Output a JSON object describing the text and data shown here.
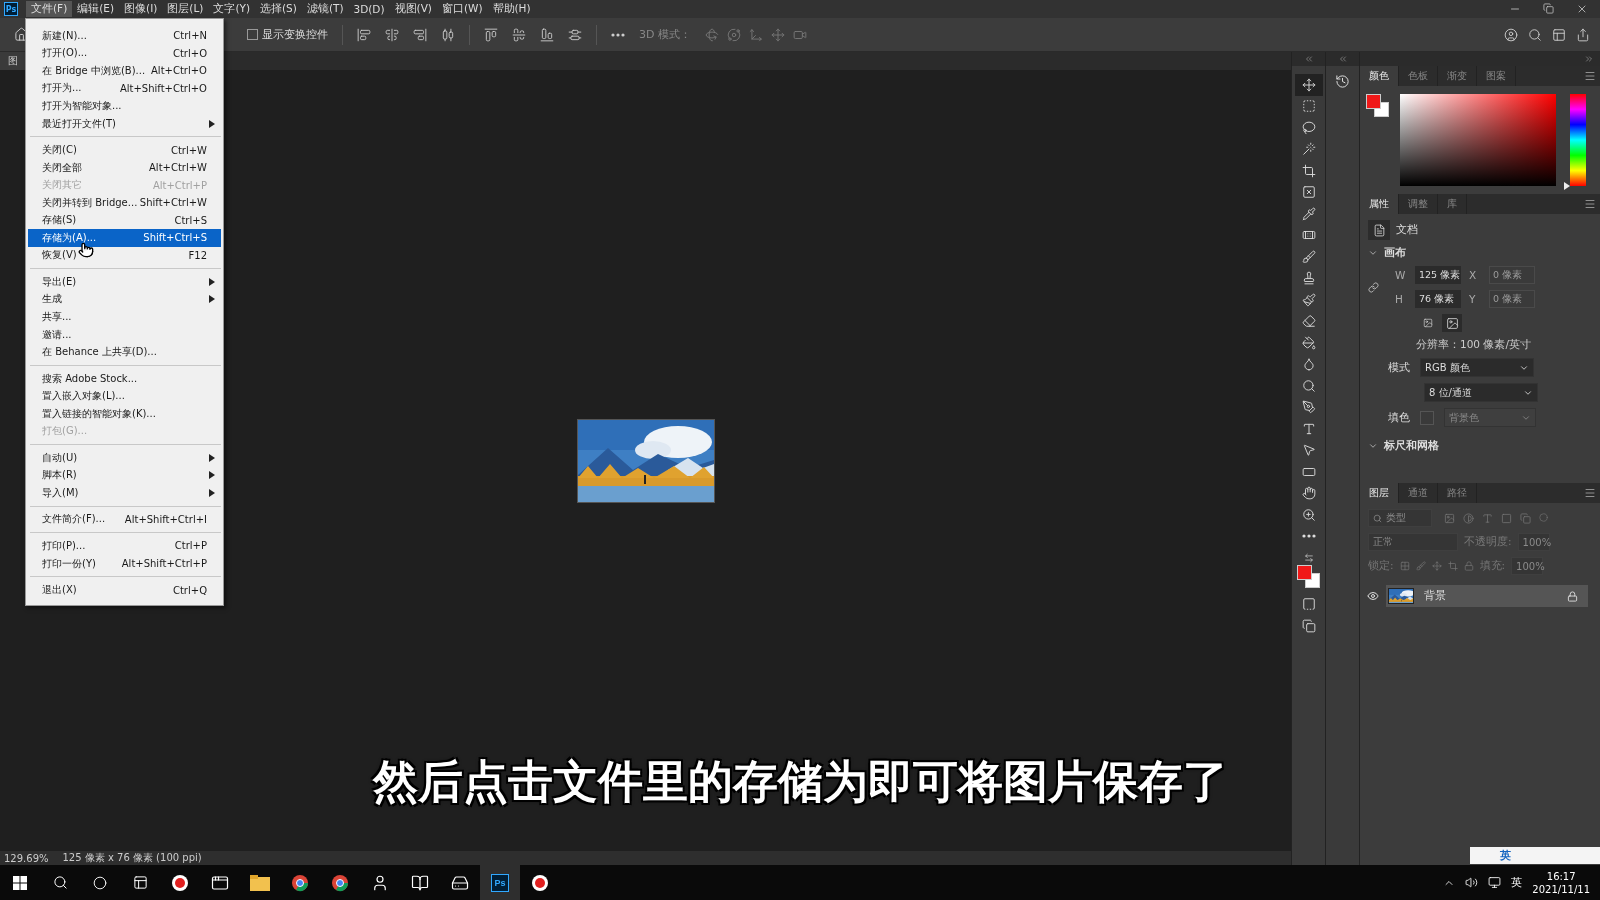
{
  "app": {
    "logo": "Ps"
  },
  "menubar": [
    {
      "label": "文件(F)",
      "selected": true
    },
    {
      "label": "编辑(E)",
      "selected": false
    },
    {
      "label": "图像(I)",
      "selected": false
    },
    {
      "label": "图层(L)",
      "selected": false
    },
    {
      "label": "文字(Y)",
      "selected": false
    },
    {
      "label": "选择(S)",
      "selected": false
    },
    {
      "label": "滤镜(T)",
      "selected": false
    },
    {
      "label": "3D(D)",
      "selected": false
    },
    {
      "label": "视图(V)",
      "selected": false
    },
    {
      "label": "窗口(W)",
      "selected": false
    },
    {
      "label": "帮助(H)",
      "selected": false
    }
  ],
  "options_bar": {
    "show_transform": {
      "label": "显示变换控件",
      "checked": false
    },
    "mode_3d": "3D 模式："
  },
  "document_tab": {
    "label": "图"
  },
  "file_menu": [
    {
      "kind": "item",
      "label": "新建(N)...",
      "shortcut": "Ctrl+N",
      "submenu": false,
      "disabled": false,
      "selected": false
    },
    {
      "kind": "item",
      "label": "打开(O)...",
      "shortcut": "Ctrl+O",
      "submenu": false,
      "disabled": false,
      "selected": false
    },
    {
      "kind": "item",
      "label": "在 Bridge 中浏览(B)...",
      "shortcut": "Alt+Ctrl+O",
      "submenu": false,
      "disabled": false,
      "selected": false
    },
    {
      "kind": "item",
      "label": "打开为...",
      "shortcut": "Alt+Shift+Ctrl+O",
      "submenu": false,
      "disabled": false,
      "selected": false
    },
    {
      "kind": "item",
      "label": "打开为智能对象...",
      "submenu": false,
      "disabled": false,
      "selected": false
    },
    {
      "kind": "item",
      "label": "最近打开文件(T)",
      "submenu": true,
      "disabled": false,
      "selected": false
    },
    {
      "kind": "separator"
    },
    {
      "kind": "item",
      "label": "关闭(C)",
      "shortcut": "Ctrl+W",
      "submenu": false,
      "disabled": false,
      "selected": false
    },
    {
      "kind": "item",
      "label": "关闭全部",
      "shortcut": "Alt+Ctrl+W",
      "submenu": false,
      "disabled": false,
      "selected": false
    },
    {
      "kind": "item",
      "label": "关闭其它",
      "shortcut": "Alt+Ctrl+P",
      "submenu": false,
      "disabled": true,
      "selected": false
    },
    {
      "kind": "item",
      "label": "关闭并转到 Bridge...",
      "shortcut": "Shift+Ctrl+W",
      "submenu": false,
      "disabled": false,
      "selected": false
    },
    {
      "kind": "item",
      "label": "存储(S)",
      "shortcut": "Ctrl+S",
      "submenu": false,
      "disabled": false,
      "selected": false
    },
    {
      "kind": "item",
      "label": "存储为(A)...",
      "shortcut": "Shift+Ctrl+S",
      "submenu": false,
      "disabled": false,
      "selected": true
    },
    {
      "kind": "item",
      "label": "恢复(V)",
      "shortcut": "F12",
      "submenu": false,
      "disabled": false,
      "selected": false
    },
    {
      "kind": "separator"
    },
    {
      "kind": "item",
      "label": "导出(E)",
      "submenu": true,
      "disabled": false,
      "selected": false
    },
    {
      "kind": "item",
      "label": "生成",
      "submenu": true,
      "disabled": false,
      "selected": false
    },
    {
      "kind": "item",
      "label": "共享...",
      "submenu": false,
      "disabled": false,
      "selected": false
    },
    {
      "kind": "item",
      "label": "邀请...",
      "submenu": false,
      "disabled": false,
      "selected": false
    },
    {
      "kind": "item",
      "label": "在 Behance 上共享(D)...",
      "submenu": false,
      "disabled": false,
      "selected": false
    },
    {
      "kind": "separator"
    },
    {
      "kind": "item",
      "label": "搜索 Adobe Stock...",
      "submenu": false,
      "disabled": false,
      "selected": false
    },
    {
      "kind": "item",
      "label": "置入嵌入对象(L)...",
      "submenu": false,
      "disabled": false,
      "selected": false
    },
    {
      "kind": "item",
      "label": "置入链接的智能对象(K)...",
      "submenu": false,
      "disabled": false,
      "selected": false
    },
    {
      "kind": "item",
      "label": "打包(G)...",
      "submenu": false,
      "disabled": true,
      "selected": false
    },
    {
      "kind": "separator"
    },
    {
      "kind": "item",
      "label": "自动(U)",
      "submenu": true,
      "disabled": false,
      "selected": false
    },
    {
      "kind": "item",
      "label": "脚本(R)",
      "submenu": true,
      "disabled": false,
      "selected": false
    },
    {
      "kind": "item",
      "label": "导入(M)",
      "submenu": true,
      "disabled": false,
      "selected": false
    },
    {
      "kind": "separator"
    },
    {
      "kind": "item",
      "label": "文件简介(F)...",
      "shortcut": "Alt+Shift+Ctrl+I",
      "submenu": false,
      "disabled": false,
      "selected": false
    },
    {
      "kind": "separator"
    },
    {
      "kind": "item",
      "label": "打印(P)...",
      "shortcut": "Ctrl+P",
      "submenu": false,
      "disabled": false,
      "selected": false
    },
    {
      "kind": "item",
      "label": "打印一份(Y)",
      "shortcut": "Alt+Shift+Ctrl+P",
      "submenu": false,
      "disabled": false,
      "selected": false
    },
    {
      "kind": "separator"
    },
    {
      "kind": "item",
      "label": "退出(X)",
      "shortcut": "Ctrl+Q",
      "submenu": false,
      "disabled": false,
      "selected": false
    }
  ],
  "tools": [
    {
      "kind": "move",
      "selected": true
    },
    {
      "kind": "marquee",
      "selected": false
    },
    {
      "kind": "lasso",
      "selected": false
    },
    {
      "kind": "wand",
      "selected": false
    },
    {
      "kind": "crop",
      "selected": false
    },
    {
      "kind": "frame",
      "selected": false
    },
    {
      "kind": "eyedropper",
      "selected": false
    },
    {
      "kind": "healing",
      "selected": false
    },
    {
      "kind": "brush",
      "selected": false
    },
    {
      "kind": "stamp",
      "selected": false
    },
    {
      "kind": "history-brush",
      "selected": false
    },
    {
      "kind": "eraser",
      "selected": false
    },
    {
      "kind": "bucket",
      "selected": false
    },
    {
      "kind": "blur",
      "selected": false
    },
    {
      "kind": "dodge",
      "selected": false
    },
    {
      "kind": "pen",
      "selected": false
    },
    {
      "kind": "type",
      "selected": false
    },
    {
      "kind": "path-select",
      "selected": false
    },
    {
      "kind": "rectangle",
      "selected": false
    },
    {
      "kind": "hand",
      "selected": false
    },
    {
      "kind": "zoom",
      "selected": false
    },
    {
      "kind": "more",
      "selected": false
    }
  ],
  "color_panel": {
    "hue_slider": {
      "level": 0
    },
    "tabs": [
      {
        "label": "颜色",
        "selected": true
      },
      {
        "label": "色板",
        "selected": false
      },
      {
        "label": "渐变",
        "selected": false
      },
      {
        "label": "图案",
        "selected": false
      }
    ]
  },
  "properties_panel": {
    "tabs": [
      {
        "label": "属性",
        "selected": true
      },
      {
        "label": "调整",
        "selected": false
      },
      {
        "label": "库",
        "selected": false
      }
    ],
    "doc_label": "文档",
    "canvas_title": "画布",
    "fields": [
      {
        "label": "W",
        "value": "125 像素",
        "disabled": false
      },
      {
        "label": "X",
        "value": "0 像素",
        "disabled": true
      },
      {
        "label": "H",
        "value": "76 像素",
        "disabled": false
      },
      {
        "label": "Y",
        "value": "0 像素",
        "disabled": true
      }
    ],
    "orientation": [
      {
        "kind": "portrait",
        "selected": false
      },
      {
        "kind": "landscape",
        "selected": true
      }
    ],
    "resolution": "分辨率：100 像素/英寸",
    "mode_label": "模式",
    "mode_value": "RGB 颜色",
    "depth_value": "8 位/通道",
    "fill_label": "填色",
    "fill_value": "背景色",
    "rulers_title": "标尺和网格"
  },
  "layers_panel": {
    "tabs": [
      {
        "label": "图层",
        "selected": true
      },
      {
        "label": "通道",
        "selected": false
      },
      {
        "label": "路径",
        "selected": false
      }
    ],
    "filter_placeholder": "类型",
    "blend": "正常",
    "opacity_label": "不透明度:",
    "opacity": "100%",
    "lock_label": "锁定:",
    "fill_label": "填充:",
    "fill": "100%",
    "layers": [
      {
        "name": "背景",
        "visible": true,
        "selected": true,
        "locked": true
      }
    ]
  },
  "status_bar": {
    "zoom": "129.69%",
    "info": "125 像素 x 76 像素 (100 ppi)"
  },
  "caption": "然后点击文件里的存储为即可将图片保存了",
  "ime_bar": {
    "label": "英"
  },
  "taskbar": {
    "apps": [
      {
        "kind": "record",
        "selected": false
      },
      {
        "kind": "window",
        "selected": false
      },
      {
        "kind": "folder",
        "selected": false
      },
      {
        "kind": "browser",
        "selected": false
      },
      {
        "kind": "browser",
        "selected": false
      },
      {
        "kind": "figure",
        "selected": false
      },
      {
        "kind": "book",
        "selected": false
      },
      {
        "kind": "disk",
        "selected": false
      },
      {
        "kind": "ps",
        "label": "Ps",
        "selected": true
      },
      {
        "kind": "record",
        "selected": false
      }
    ],
    "tray_lang": "英",
    "time": "16:17",
    "date": "2021/11/11"
  }
}
